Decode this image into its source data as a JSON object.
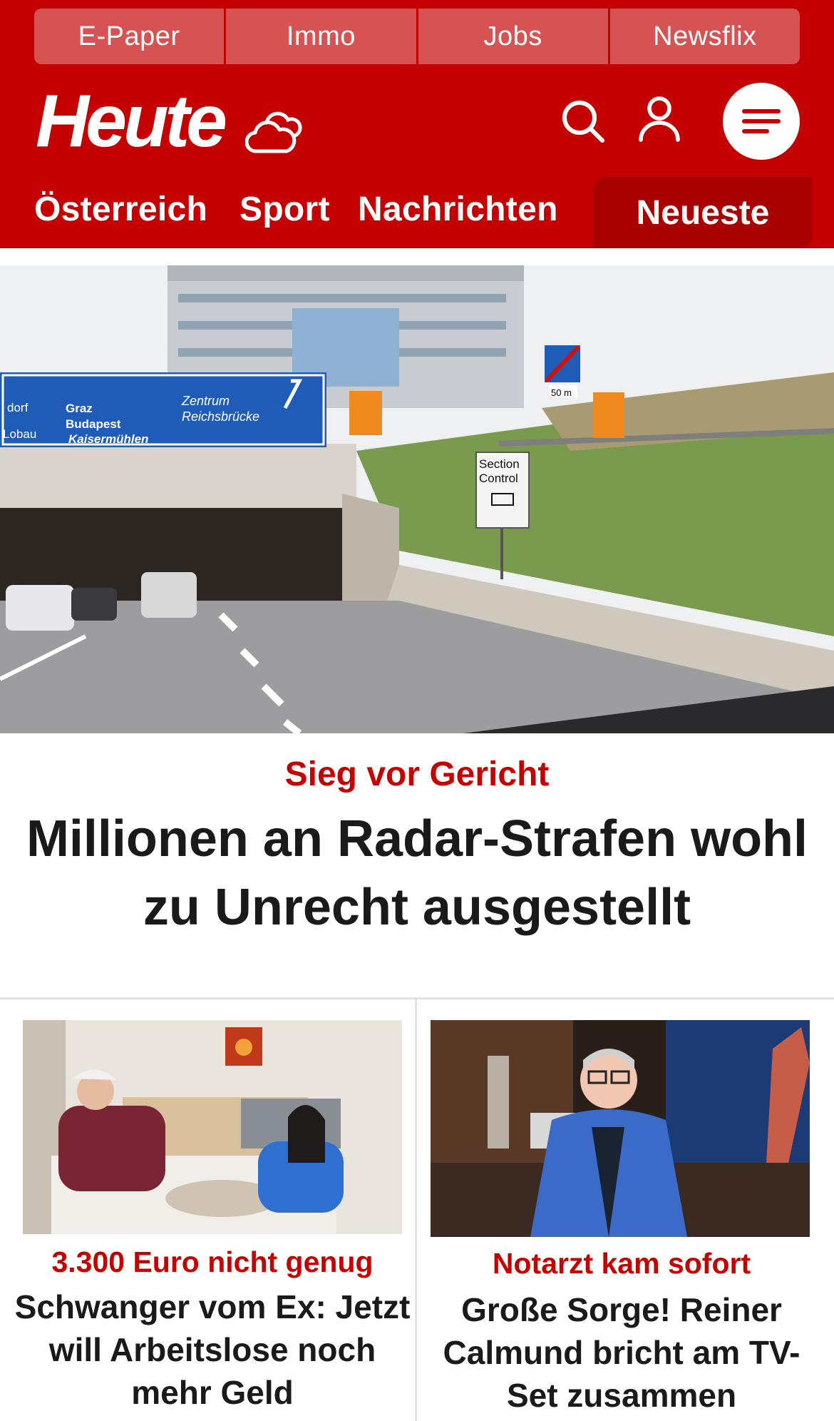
{
  "quicklinks": [
    "E-Paper",
    "Immo",
    "Jobs",
    "Newsflix"
  ],
  "brand": {
    "logo_text": "Heute",
    "accent_color": "#c40000"
  },
  "header_icons": [
    "weather-icon",
    "search-icon",
    "user-icon",
    "menu-icon"
  ],
  "nav": {
    "items": [
      "Österreich",
      "Sport",
      "Nachrichten"
    ],
    "active": "Neueste"
  },
  "hero": {
    "image_text": {
      "sign_left_1": "dorf",
      "sign_left_2": "Lobau",
      "sign_mid_1": "Graz",
      "sign_mid_2": "Budapest",
      "sign_mid_3": "Kaisermühlen",
      "sign_right_1": "Zentrum",
      "sign_right_2": "Reichsbrücke",
      "speed": "50 m",
      "section_1": "Section",
      "section_2": "Control"
    },
    "kicker": "Sieg vor Gericht",
    "title": "Millionen an Radar-Strafen wohl zu Unrecht ausgestellt"
  },
  "cards": [
    {
      "kicker": "3.300 Euro nicht genug",
      "title": "Schwanger vom Ex: Jetzt will Arbeitslose noch mehr Geld"
    },
    {
      "kicker": "Notarzt kam sofort",
      "title": "Große Sorge! Reiner Calmund bricht am TV-Set zusammen"
    }
  ]
}
